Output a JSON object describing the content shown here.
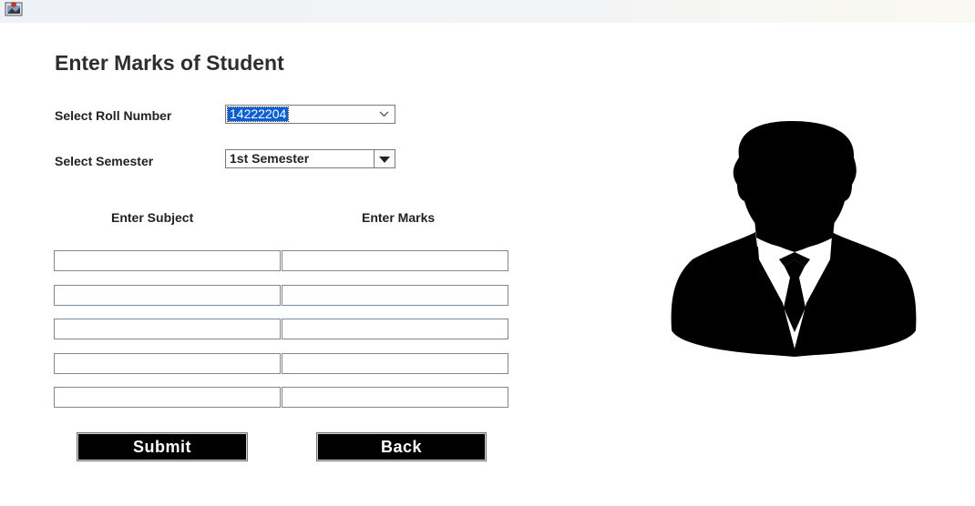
{
  "window": {
    "icon": "app-icon"
  },
  "page": {
    "title": "Enter Marks of Student"
  },
  "roll": {
    "label": "Select Roll Number",
    "value": "14222204"
  },
  "semester": {
    "label": "Select Semester",
    "value": "1st Semester"
  },
  "table": {
    "subject_header": "Enter Subject",
    "marks_header": "Enter Marks",
    "rows": [
      {
        "subject": "",
        "marks": ""
      },
      {
        "subject": "",
        "marks": ""
      },
      {
        "subject": "",
        "marks": ""
      },
      {
        "subject": "",
        "marks": ""
      },
      {
        "subject": "",
        "marks": ""
      }
    ]
  },
  "actions": {
    "submit_label": "Submit",
    "back_label": "Back"
  },
  "avatar": {
    "icon": "student-avatar-icon"
  },
  "colors": {
    "selection": "#0a5fd8",
    "button_bg": "#000000",
    "button_text": "#ffffff"
  }
}
